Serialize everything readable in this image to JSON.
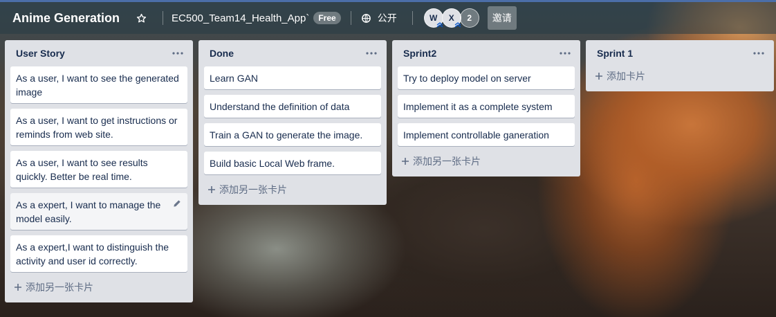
{
  "header": {
    "board_title": "Anime Generation",
    "team_name": "EC500_Team14_Health_App`",
    "plan_badge": "Free",
    "visibility": "公开",
    "members": [
      "W",
      "X"
    ],
    "member_count": "2",
    "invite_label": "邀请"
  },
  "lists": [
    {
      "title": "User Story",
      "cards": [
        "As a user, I want to see the generated image",
        "As a user, I want to get instructions or reminds from web site.",
        "As a user, I want to see results quickly. Better be real time.",
        "As a expert, I want to manage the model easily.",
        "As a expert,I want to distinguish the activity and user id correctly."
      ],
      "add_label": "添加另一张卡片"
    },
    {
      "title": "Done",
      "cards": [
        "Learn GAN",
        "Understand the definition of data",
        "Train a GAN to generate the image.",
        "Build basic Local Web frame."
      ],
      "add_label": "添加另一张卡片"
    },
    {
      "title": "Sprint2",
      "cards": [
        "Try to deploy model on server",
        "Implement it as a complete system",
        "Implement controllable ganeration"
      ],
      "add_label": "添加另一张卡片"
    },
    {
      "title": "Sprint 1",
      "cards": [],
      "add_label": "添加卡片"
    }
  ],
  "colors": {
    "header_bar": "#4b6ea8",
    "list_bg": "#dfe1e6",
    "card_bg": "#ffffff",
    "text": "#172b4d",
    "muted": "#5e6c84"
  }
}
